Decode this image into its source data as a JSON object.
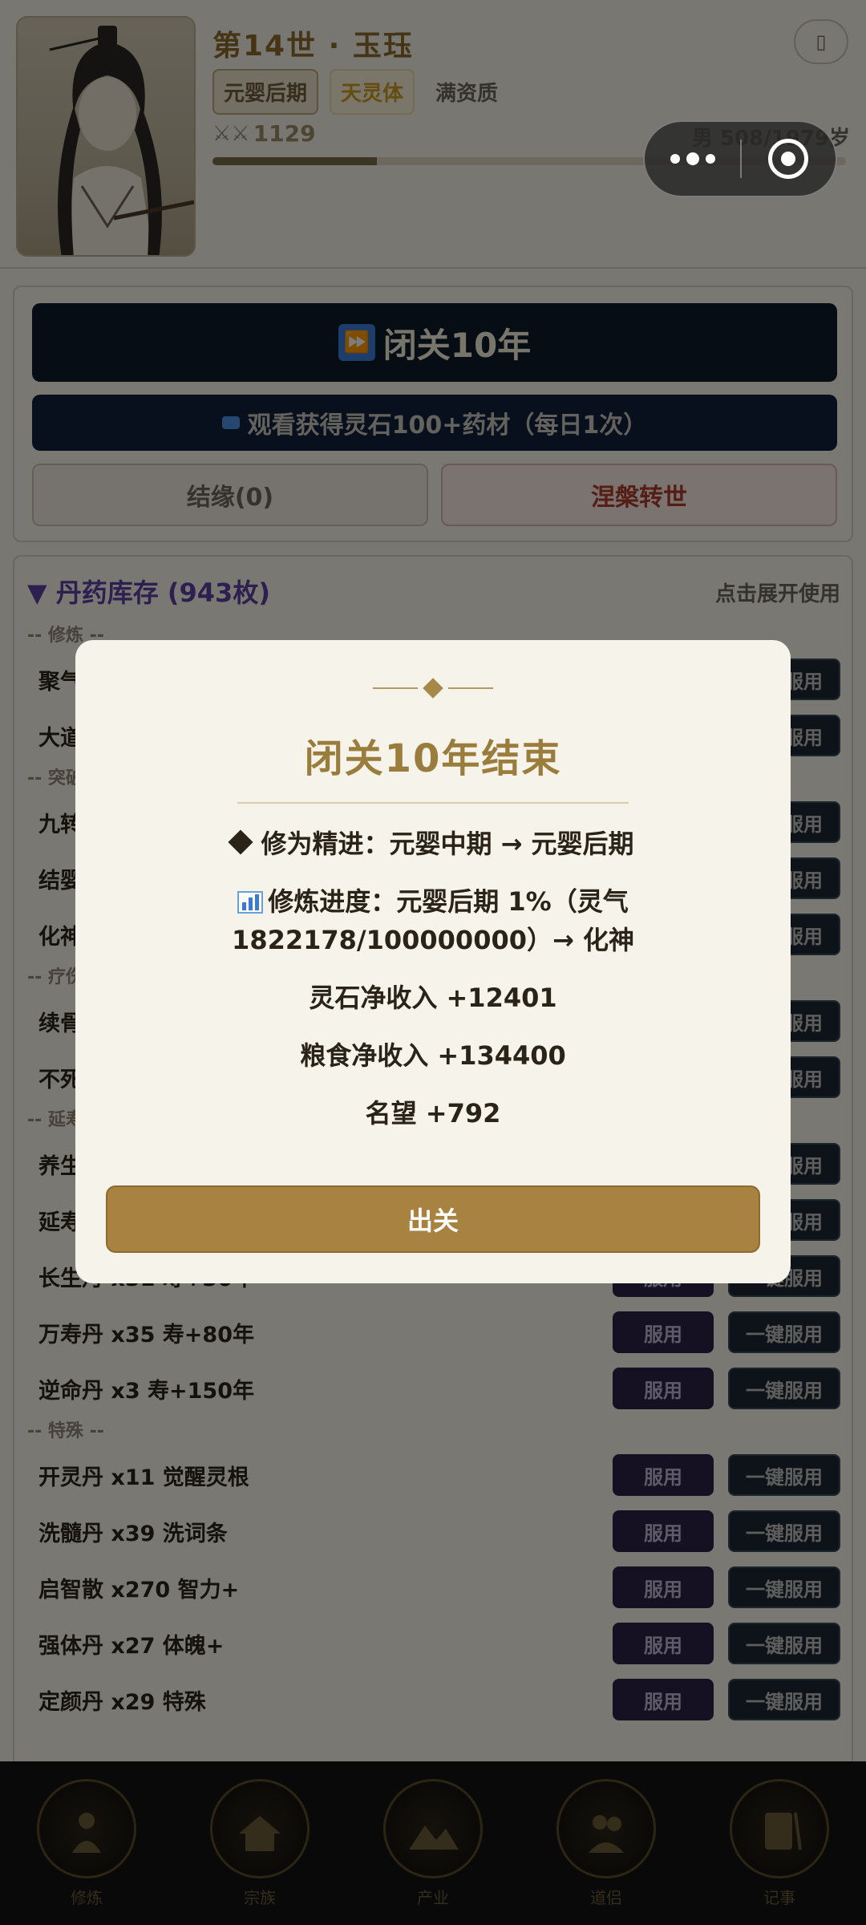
{
  "header": {
    "title": "第14世 · 玉珏",
    "realm_tag": "元婴后期",
    "root_tag": "天灵体",
    "aptitude": "满资质",
    "power": "1129",
    "age_text": "男 508/1979岁",
    "age_progress": 0.26,
    "mail_icon": "scroll-icon"
  },
  "capsule": {
    "more_icon": "more-dots-icon",
    "close_icon": "target-close-icon"
  },
  "actions": {
    "retreat_label": "闭关10年",
    "watch_label": "观看获得灵石100+药材（每日1次）",
    "bond_label": "结缘(0)",
    "rebirth_label": "涅槃转世"
  },
  "inventory": {
    "title": "▼ 丹药库存 (943枚)",
    "hint": "点击展开使用",
    "use_label": "服用",
    "useall_label": "一键服用",
    "categories": [
      {
        "name": "-- 修炼 --",
        "items": [
          "聚气",
          "大道"
        ]
      },
      {
        "name": "-- 突破 --",
        "items": [
          "九转",
          "结婴",
          "化神"
        ]
      },
      {
        "name": "-- 疗伤 --",
        "items": [
          "续骨",
          "不死"
        ]
      },
      {
        "name": "-- 延寿 --",
        "items": [
          "养生",
          "延寿",
          "长生丹 x51  寿+30年",
          "万寿丹 x35  寿+80年",
          "逆命丹 x3  寿+150年"
        ]
      },
      {
        "name": "-- 特殊 --",
        "items": [
          "开灵丹 x11  觉醒灵根",
          "洗髓丹 x39  洗词条",
          "启智散 x270  智力+",
          "强体丹 x27  体魄+",
          "定颜丹 x29  特殊"
        ]
      }
    ]
  },
  "nav": {
    "items": [
      "修炼",
      "宗族",
      "产业",
      "道侣",
      "记事"
    ]
  },
  "modal": {
    "title": "闭关10年结束",
    "breakthrough": "修为精进：元婴中期 → 元婴后期",
    "progress": "修炼进度：元婴后期 1%（灵气1822178/100000000）→ 化神",
    "stones": "灵石净收入 +12401",
    "grain": "粮食净收入 +134400",
    "fame": "名望 +792",
    "exit_label": "出关"
  }
}
